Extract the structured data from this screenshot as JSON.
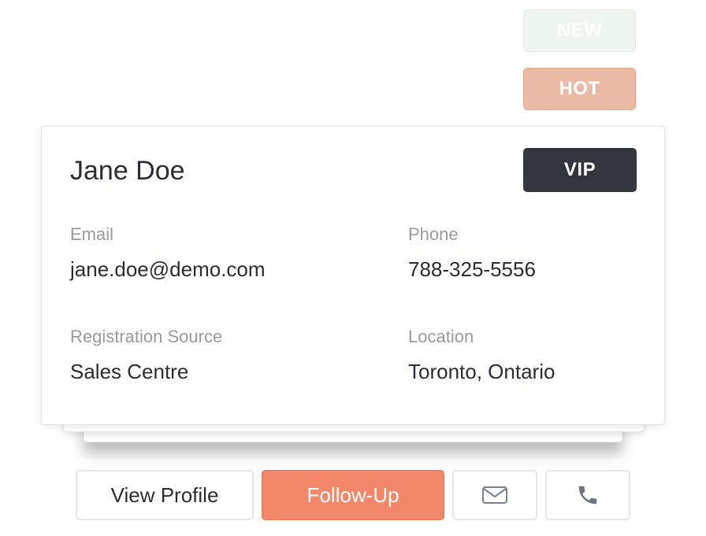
{
  "tags": {
    "new": "NEW",
    "hot": "HOT"
  },
  "contact": {
    "name": "Jane Doe",
    "badge": "VIP",
    "fields": {
      "email": {
        "label": "Email",
        "value": "jane.doe@demo.com"
      },
      "phone": {
        "label": "Phone",
        "value": "788-325-5556"
      },
      "source": {
        "label": "Registration Source",
        "value": "Sales Centre"
      },
      "location": {
        "label": "Location",
        "value": "Toronto, Ontario"
      }
    }
  },
  "actions": {
    "view_profile": "View Profile",
    "follow_up": "Follow-Up",
    "email_icon": "envelope-icon",
    "phone_icon": "phone-icon"
  },
  "colors": {
    "accent": "#f2876a",
    "vip_bg": "#33363d",
    "hot_tag": "#ebbaa6",
    "new_tag": "#eef4ee",
    "label_gray": "#9a9a9a",
    "text_dark": "#2c2d33"
  }
}
